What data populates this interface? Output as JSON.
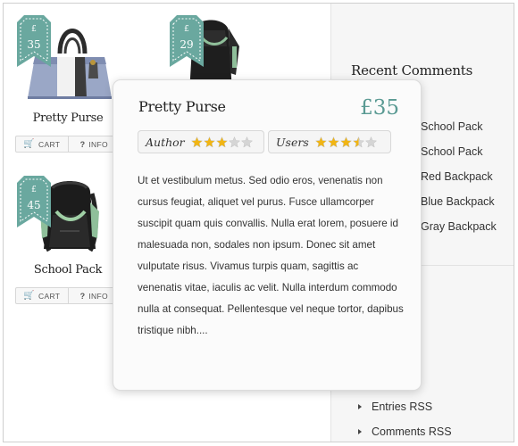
{
  "colors": {
    "accent": "#5a9a93",
    "tag": "#6aa89f",
    "star_filled": "#f1b514",
    "star_empty": "#d5d5d5"
  },
  "products": [
    {
      "name": "Pretty Purse",
      "price": "35",
      "currency": "£"
    },
    {
      "name": "",
      "price": "29",
      "currency": "£"
    },
    {
      "name": "School Pack",
      "price": "45",
      "currency": "£"
    }
  ],
  "buttons": {
    "cart": "CART",
    "info": "INFO"
  },
  "popup": {
    "title": "Pretty Purse",
    "price": "£35",
    "author_label": "Author",
    "users_label": "Users",
    "author_rating": 3,
    "users_rating": 3.5,
    "max_rating": 5,
    "body": "Ut et vestibulum metus. Sed odio eros, venenatis non cursus feugiat, aliquet vel purus. Fusce ullamcorper suscipit quam quis convallis. Nulla erat lorem, posuere id malesuada non, sodales non ipsum. Donec sit amet vulputate risus. Vivamus turpis quam, sagittis ac venenatis vitae, iaculis ac velit. Nulla interdum commodo nulla at consequat. Pellentesque vel neque tortor, dapibus tristique nibh...."
  },
  "sidebar": {
    "recent_comments_title": "Recent Comments",
    "recent_comments": [
      "School Pack",
      "School Pack",
      "Red Backpack",
      "Blue Backpack",
      "Gray Backpack"
    ],
    "meta_partial": "n",
    "meta_items": [
      "Entries RSS",
      "Comments RSS"
    ]
  }
}
